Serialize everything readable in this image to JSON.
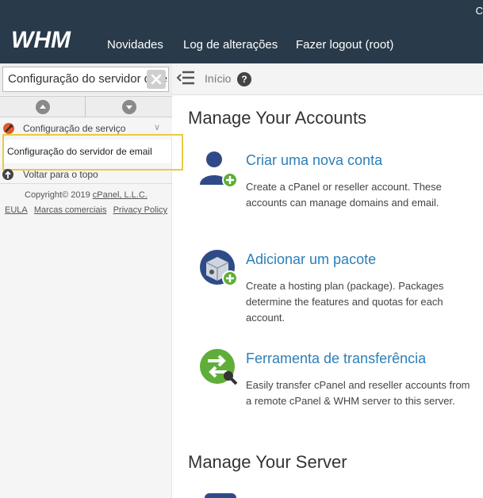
{
  "header": {
    "logo_text": "WHM",
    "nav": [
      "Novidades",
      "Log de alterações",
      "Fazer logout (root)"
    ],
    "corner_text": "C"
  },
  "sidebar": {
    "search_value": "Configuração do servidor de em",
    "section_label": "Configuração de serviço",
    "active_item": "Configuração do servidor de email",
    "back_to_top": "Voltar para o topo",
    "copyright_prefix": "Copyright© 2019 ",
    "copyright_link": "cPanel, L.L.C.",
    "footer_links": [
      "EULA",
      "Marcas comerciais",
      "Privacy Policy"
    ]
  },
  "breadcrumb": {
    "home": "Início"
  },
  "main": {
    "sections": [
      {
        "heading": "Manage Your Accounts",
        "items": [
          {
            "title": "Criar uma nova conta",
            "description": "Create a cPanel or reseller account. These accounts can manage domains and email.",
            "icon": "add-user-icon"
          },
          {
            "title": "Adicionar um pacote",
            "description": "Create a hosting plan (package). Packages determine the features and quotas for each account.",
            "icon": "add-package-icon"
          },
          {
            "title": "Ferramenta de transferência",
            "description": "Easily transfer cPanel and reseller accounts from a remote cPanel & WHM server to this server.",
            "icon": "transfer-tool-icon"
          }
        ]
      },
      {
        "heading": "Manage Your Server"
      }
    ]
  },
  "colors": {
    "header_bg": "#293a4a",
    "link": "#2d7fb8",
    "highlight": "#e8cb44",
    "green": "#5fae3a"
  }
}
